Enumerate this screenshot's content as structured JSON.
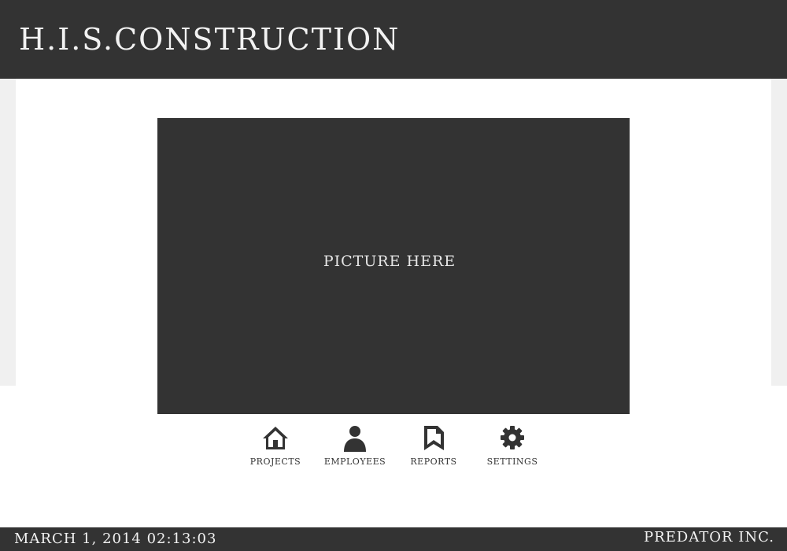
{
  "header": {
    "title": "H.I.S.CONSTRUCTION"
  },
  "main": {
    "picture_placeholder": "PICTURE HERE"
  },
  "nav": {
    "items": [
      {
        "label": "PROJECTS",
        "icon": "home-icon"
      },
      {
        "label": "EMPLOYEES",
        "icon": "person-icon"
      },
      {
        "label": "REPORTS",
        "icon": "report-icon"
      },
      {
        "label": "SETTINGS",
        "icon": "gear-icon"
      }
    ]
  },
  "footer": {
    "datetime": "MARCH 1, 2014 02:13:03",
    "company": "PREDATOR INC."
  },
  "colors": {
    "dark": "#333333",
    "light_text": "#f2f2f2",
    "side_band": "#f0f0f0",
    "background": "#ffffff"
  }
}
